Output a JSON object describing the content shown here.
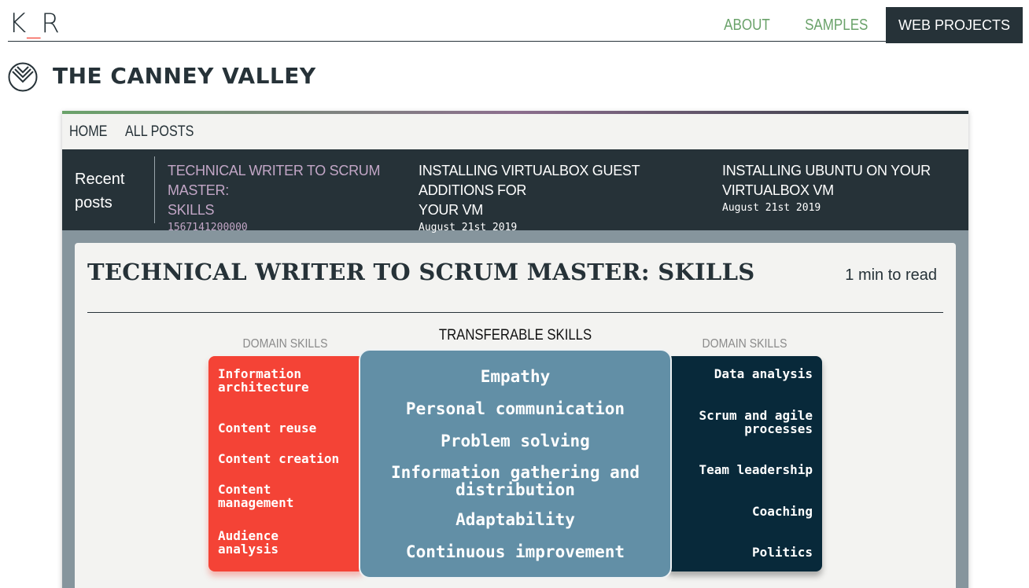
{
  "site": {
    "logo_prefix": "K",
    "logo_underscore": "_",
    "logo_suffix": "R",
    "nav": [
      "ABOUT",
      "SAMPLES",
      "WEB PROJECTS"
    ]
  },
  "blog": {
    "title": "THE CANNEY VALLEY"
  },
  "breadcrumbs": [
    "HOME",
    "ALL POSTS"
  ],
  "recent": {
    "label_line1": "Recent",
    "label_line2": "posts",
    "items": [
      {
        "title_line1": "TECHNICAL WRITER TO SCRUM MASTER:",
        "title_line2": "SKILLS",
        "date": "1567141200000"
      },
      {
        "title_line1": "INSTALLING VIRTUALBOX GUEST ADDITIONS FOR",
        "title_line2": "YOUR VM",
        "date": "August 21st 2019"
      },
      {
        "title_line1": "INSTALLING UBUNTU ON YOUR",
        "title_line2": "VIRTUALBOX VM",
        "date": "August 21st 2019"
      }
    ]
  },
  "post": {
    "title": "TECHNICAL WRITER TO SCRUM MASTER: SKILLS",
    "read_time": "1 min to read"
  },
  "diagram": {
    "left_caption": "DOMAIN SKILLS",
    "center_caption": "TRANSFERABLE SKILLS",
    "right_caption": "DOMAIN SKILLS",
    "left": [
      [
        "Information",
        "architecture"
      ],
      [
        "Content reuse"
      ],
      [
        "Content creation"
      ],
      [
        "Content",
        "management"
      ],
      [
        "Audience",
        "analysis"
      ]
    ],
    "center": [
      [
        "Empathy"
      ],
      [
        "Personal communication"
      ],
      [
        "Problem solving"
      ],
      [
        "Information gathering and",
        "distribution"
      ],
      [
        "Adaptability"
      ],
      [
        "Continuous improvement"
      ]
    ],
    "right": [
      [
        "Data analysis"
      ],
      [
        "Scrum and agile",
        "processes"
      ],
      [
        "Team leadership"
      ],
      [
        "Coaching"
      ],
      [
        "Politics"
      ]
    ],
    "colors": {
      "left": "#f44336",
      "center": "#628fa6",
      "right": "#08293a"
    }
  }
}
